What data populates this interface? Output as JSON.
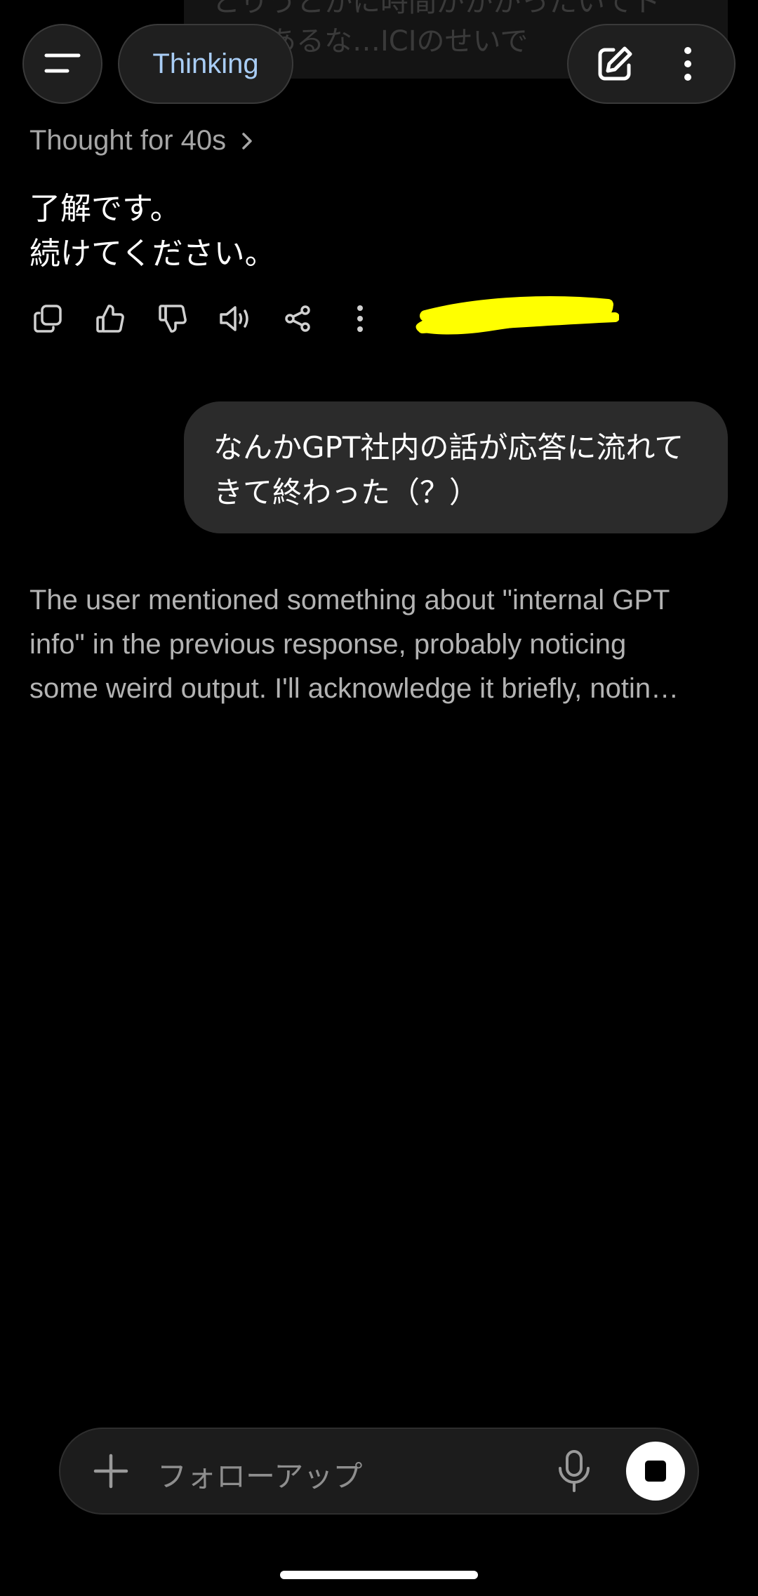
{
  "background_message": {
    "line1": "とりうとかに時間がかかったいてト",
    "line2": "なさあるな…ICIのせいで"
  },
  "header": {
    "model_label": "Thinking"
  },
  "assistant": {
    "thought_label": "Thought for 40s",
    "line1": "了解です。",
    "line2": "続けてください。"
  },
  "user_message": {
    "line1": "なんかGPT社内の話が応答に流れて",
    "line2": "きて終わった（？）"
  },
  "thinking_preview": {
    "line1": "The user mentioned something about \"internal GPT",
    "line2": "info\" in the previous response, probably noticing",
    "line3": "some weird output. I'll acknowledge it briefly, notin…"
  },
  "composer": {
    "placeholder": "フォローアップ"
  },
  "colors": {
    "background": "#000000",
    "accent_model": "#a9cdf5",
    "redaction": "#ffff00",
    "bubble": "#2b2b2b"
  },
  "icons": {
    "menu": "menu-icon",
    "compose": "edit-icon",
    "more": "more-vertical-icon",
    "copy": "copy-icon",
    "like": "thumbs-up-icon",
    "dislike": "thumbs-down-icon",
    "read_aloud": "speaker-icon",
    "share": "share-icon",
    "add": "plus-icon",
    "mic": "mic-icon",
    "stop": "stop-icon"
  }
}
